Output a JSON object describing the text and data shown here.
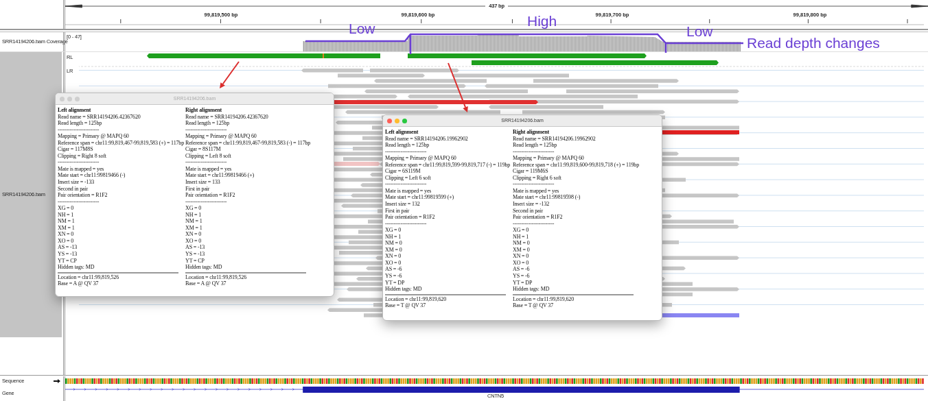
{
  "ruler": {
    "span": "437 bp",
    "ticks": [
      {
        "label": "99,819,500 bp"
      },
      {
        "label": "99,819,600 bp"
      },
      {
        "label": "99,819,700 bp"
      },
      {
        "label": "99,819,800 bp"
      }
    ]
  },
  "coverage_track": {
    "name": "SRR14194206.bam Coverage",
    "range": "[0 - 47]"
  },
  "alignment_track": {
    "name": "SRR14194206.bam",
    "groups": [
      {
        "label": "RL"
      },
      {
        "label": "LR"
      }
    ]
  },
  "annotations": [
    {
      "text": "Low"
    },
    {
      "text": "High"
    },
    {
      "text": "Low"
    },
    {
      "text": "Read depth changes"
    }
  ],
  "popups": [
    {
      "title": "SRR14194206.bam",
      "focused": false,
      "columns": [
        {
          "heading": "Left alignment",
          "lines": [
            "Read name = SRR14194206.42367620",
            "Read length = 125bp",
            "------------------------",
            "Mapping = Primary @ MAPQ 60",
            "Reference span = chr11:99,819,467-99,819,583 (+) = 117bp",
            "Cigar = 117M8S",
            "Clipping = Right 8 soft",
            "------------------------",
            "Mate is mapped = yes",
            "Mate start = chr11:99819466 (-)",
            "Insert size = -133",
            "Second in pair",
            "Pair orientation = R1F2",
            "------------------------",
            "XG = 0",
            "NH = 1",
            "NM = 1",
            "XM = 1",
            "XN = 0",
            "XO = 0",
            "AS = -13",
            "YS = -13",
            "YT = CP",
            "Hidden tags: MD"
          ],
          "footer": [
            "Location = chr11:99,819,526",
            "Base = A @ QV 37"
          ]
        },
        {
          "heading": "Right alignment",
          "lines": [
            "Read name = SRR14194206.42367620",
            "Read length = 125bp",
            "------------------------",
            "Mapping = Primary @ MAPQ 60",
            "Reference span = chr11:99,819,467-99,819,583 (-) = 117bp",
            "Cigar = 8S117M",
            "Clipping = Left 8 soft",
            "------------------------",
            "Mate is mapped = yes",
            "Mate start = chr11:99819466 (+)",
            "Insert size = 133",
            "First in pair",
            "Pair orientation = R1F2",
            "------------------------",
            "XG = 0",
            "NH = 1",
            "NM = 1",
            "XM = 1",
            "XN = 0",
            "XO = 0",
            "AS = -13",
            "YS = -13",
            "YT = CP",
            "Hidden tags: MD"
          ],
          "footer": [
            "Location = chr11:99,819,526",
            "Base = A @ QV 37"
          ]
        }
      ]
    },
    {
      "title": "SRR14194206.bam",
      "focused": true,
      "columns": [
        {
          "heading": "Left alignment",
          "lines": [
            "Read name = SRR14194206.19962902",
            "Read length = 125bp",
            "------------------------",
            "Mapping = Primary @ MAPQ 60",
            "Reference span = chr11:99,819,599-99,819,717 (-) = 119bp",
            "Cigar = 6S119M",
            "Clipping = Left 6 soft",
            "------------------------",
            "Mate is mapped = yes",
            "Mate start = chr11:99819599 (+)",
            "Insert size = 132",
            "First in pair",
            "Pair orientation = R1F2",
            "------------------------",
            "XG = 0",
            "NH = 1",
            "NM = 0",
            "XM = 0",
            "XN = 0",
            "XO = 0",
            "AS = -6",
            "YS = -6",
            "YT = DP",
            "Hidden tags: MD"
          ],
          "footer": [
            "Location = chr11:99,819,620",
            "Base = T @ QV 37"
          ]
        },
        {
          "heading": "Right alignment",
          "lines": [
            "Read name = SRR14194206.19962902",
            "Read length = 125bp",
            "------------------------",
            "Mapping = Primary @ MAPQ 60",
            "Reference span = chr11:99,819,600-99,819,718 (+) = 119bp",
            "Cigar = 119M6S",
            "Clipping = Right 6 soft",
            "------------------------",
            "Mate is mapped = yes",
            "Mate start = chr11:99819598 (-)",
            "Insert size = -132",
            "Second in pair",
            "Pair orientation = R1F2",
            "------------------------",
            "XG = 0",
            "NH = 1",
            "NM = 0",
            "XM = 0",
            "XN = 0",
            "XO = 0",
            "AS = -6",
            "YS = -6",
            "YT = DP",
            "Hidden tags: MD"
          ],
          "footer": [
            "Location = chr11:99,819,620",
            "Base = T @ QV 37"
          ]
        }
      ]
    }
  ],
  "sequence_track": {
    "name": "Sequence"
  },
  "gene_track": {
    "name": "Gene",
    "gene_label": "CNTN5"
  }
}
